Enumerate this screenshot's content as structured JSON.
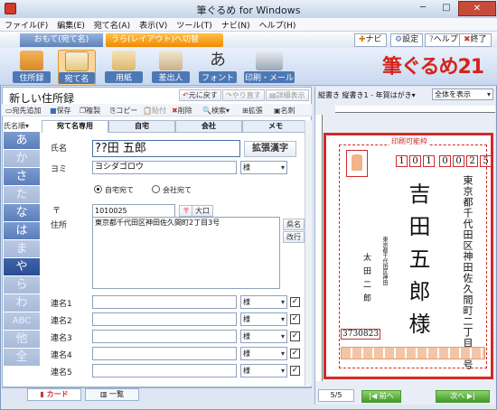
{
  "window": {
    "title": "筆ぐるめ for Windows"
  },
  "menu": [
    "ファイル(F)",
    "編集(E)",
    "宛て名(A)",
    "表示(V)",
    "ツール(T)",
    "ナビ(N)",
    "ヘルプ(H)"
  ],
  "side_tabs": {
    "front": "おもて(宛て名)",
    "back": "うら(レイアウト)へ切替"
  },
  "top_buttons": {
    "navi": "ナビ",
    "settings": "設定",
    "help": "ヘルプ",
    "exit": "終了"
  },
  "ribbon": [
    {
      "label": "住所録",
      "icon": "address-book-icon"
    },
    {
      "label": "宛て名",
      "icon": "person-card-icon"
    },
    {
      "label": "用紙",
      "icon": "paper-icon"
    },
    {
      "label": "差出人",
      "icon": "sender-icon"
    },
    {
      "label": "フォント",
      "icon": "font-icon"
    },
    {
      "label": "印刷・メール",
      "icon": "printer-icon"
    }
  ],
  "logo": "筆ぐるめ21",
  "left_pane": {
    "title": "新しい住所録",
    "buttons": {
      "undo": "元に戻す",
      "redo": "やり直す",
      "details": "詳細表示"
    },
    "toolbar": [
      "宛先追加",
      "保存",
      "複製",
      "コピー",
      "貼付",
      "削除",
      "検索",
      "拡張",
      "名刺"
    ]
  },
  "kana_header": "氏名順",
  "kana": [
    {
      "label": "あ",
      "state": "normal"
    },
    {
      "label": "か",
      "state": "dim"
    },
    {
      "label": "さ",
      "state": "normal"
    },
    {
      "label": "た",
      "state": "dim"
    },
    {
      "label": "な",
      "state": "normal"
    },
    {
      "label": "は",
      "state": "normal"
    },
    {
      "label": "ま",
      "state": "dim"
    },
    {
      "label": "や",
      "state": "selected"
    },
    {
      "label": "ら",
      "state": "dim"
    },
    {
      "label": "わ",
      "state": "dim"
    },
    {
      "label": "ABC",
      "state": "dim"
    },
    {
      "label": "他",
      "state": "dim"
    },
    {
      "label": "全",
      "state": "dim"
    }
  ],
  "form_tabs": [
    "宛て名専用",
    "自宅",
    "会社",
    "メモ"
  ],
  "form": {
    "name_label": "氏名",
    "name_value": "??田 五郎",
    "kanji_button": "拡張漢字",
    "yomi_label": "ヨミ",
    "yomi_value": "ヨシダゴロウ",
    "honorific": "様",
    "radio_home": "自宅宛て",
    "radio_company": "会社宛て",
    "zip_label": "〒",
    "zip_value": "1010025",
    "zip_btn": "〒",
    "oguchi_btn": "大口",
    "address_label": "住所",
    "address_value": "東京都千代田区神田佐久間町2丁目3号",
    "address_btn1": "県名",
    "address_btn2": "改行",
    "joint_labels": [
      "連名1",
      "連名2",
      "連名3",
      "連名4",
      "連名5"
    ],
    "joint_honorific": "様",
    "checkmark": "✓"
  },
  "bottom_tabs": {
    "card": "カード",
    "list": "一覧"
  },
  "preview": {
    "dropdown1": "縦書き 縦書き1 - 年賀はがき",
    "dropdown2": "全体を表示",
    "printable_label": "印刷可能枠",
    "zip_digits": [
      "1",
      "0",
      "1",
      "0",
      "0",
      "2",
      "5"
    ],
    "address_lines": [
      "東京都千代田区神田佐久間町二丁目三号"
    ],
    "recipient_name": "吉田五郎様",
    "sender_address": "東京都千代田区神田",
    "sender_name": "太田二郎",
    "sender_zip": "3730823",
    "page_counter": "5/5",
    "prev_btn": "前へ",
    "next_btn": "次へ"
  }
}
